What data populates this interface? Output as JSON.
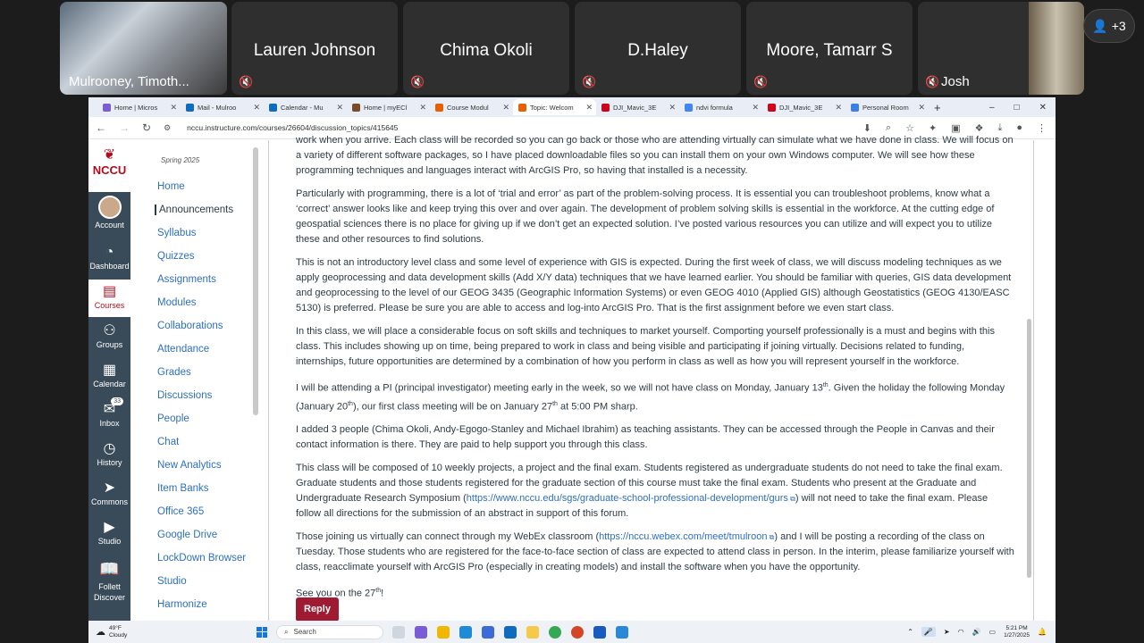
{
  "meeting": {
    "participants": [
      {
        "name": "Mulrooney, Timoth...",
        "muted": false
      },
      {
        "name": "Lauren Johnson",
        "muted": true
      },
      {
        "name": "Chima Okoli",
        "muted": true
      },
      {
        "name": "D.Haley",
        "muted": true
      },
      {
        "name": "Moore, Tamarr S",
        "muted": true
      },
      {
        "name": "Josh",
        "muted": true
      }
    ],
    "more_count": "+3"
  },
  "browser": {
    "tabs": [
      {
        "label": "Home | Micros",
        "color": "#7b5cd6"
      },
      {
        "label": "Mail - Mulroo",
        "color": "#0f6cbd"
      },
      {
        "label": "Calendar - Mu",
        "color": "#0f6cbd"
      },
      {
        "label": "Home | myECl",
        "color": "#7a4b2a"
      },
      {
        "label": "Course Modul",
        "color": "#e66000"
      },
      {
        "label": "Topic: Welcom",
        "color": "#e66000"
      },
      {
        "label": "DJI_Mavic_3E",
        "color": "#d0021b"
      },
      {
        "label": "ndvi formula",
        "color": "#4285f4"
      },
      {
        "label": "DJI_Mavic_3E",
        "color": "#d0021b"
      },
      {
        "label": "Personal Room",
        "color": "#3c7de6"
      }
    ],
    "active_tab": 5,
    "url": "nccu.instructure.com/courses/26604/discussion_topics/415645"
  },
  "global_nav": {
    "logo_text": "NCCU",
    "items": [
      {
        "label": "Account",
        "icon": "avatar-icon"
      },
      {
        "label": "Dashboard",
        "icon": "dashboard-icon"
      },
      {
        "label": "Courses",
        "icon": "book-icon",
        "active": true
      },
      {
        "label": "Groups",
        "icon": "groups-icon"
      },
      {
        "label": "Calendar",
        "icon": "calendar-icon"
      },
      {
        "label": "Inbox",
        "icon": "inbox-icon",
        "count": "33"
      },
      {
        "label": "History",
        "icon": "clock-icon"
      },
      {
        "label": "Commons",
        "icon": "commons-icon"
      },
      {
        "label": "Studio",
        "icon": "studio-icon"
      },
      {
        "label": "Follett Discover",
        "icon": "follett-icon"
      }
    ]
  },
  "course_nav": {
    "term": "Spring 2025",
    "items": [
      "Home",
      "Announcements",
      "Syllabus",
      "Quizzes",
      "Assignments",
      "Modules",
      "Collaborations",
      "Attendance",
      "Grades",
      "Discussions",
      "People",
      "Chat",
      "New Analytics",
      "Item Banks",
      "Office 365",
      "Google Drive",
      "LockDown Browser",
      "Studio",
      "Harmonize"
    ],
    "active": "Announcements"
  },
  "post": {
    "p0": "work when you arrive.  Each class will be recorded so you can go back or those who are attending virtually can simulate what we have done in class.  We will focus on a variety of different software packages, so I have placed downloadable files so you can install them on your own Windows computer.  We will see how these programming techniques and languages interact with ArcGIS Pro, so having that installed is a necessity.",
    "p1": "Particularly with programming, there is a lot of ‘trial and error’ as part of the problem-solving process.  It is essential you can troubleshoot problems, know what a ‘correct’ answer looks like and keep trying this over and over again.  The development of problem solving skills is essential in the workforce.  At the cutting edge of geospatial sciences there is no place for giving up if we don’t get an expected solution.  I’ve posted various resources you can utilize and will expect you to utilize these and other resources to find solutions.",
    "p2": "This is not an introductory level class and some level of experience with GIS is expected.  During the first week of class, we will discuss modeling techniques as we apply geoprocessing and data development skills (Add X/Y data) techniques that we have learned earlier.  You should be familiar with queries, GIS data development and geoprocessing to the level of our GEOG 3435 (Geographic Information Systems) or even GEOG 4010 (Applied GIS) although Geostatistics (GEOG 4130/EASC 5130) is preferred.  Please be sure you are able to access and log-into ArcGIS Pro.  That is the first assignment before we even start class.",
    "p3": "In this class, we will place a considerable focus on soft skills and techniques to market yourself.  Comporting yourself professionally is a must and begins with this class.  This includes showing up on time, being prepared to work in class and being visible and participating if joining virtually.   Decisions related to funding, internships, future opportunities are determined by a combination of how you perform in class as well as how you will represent yourself in the workforce.",
    "p4a": " I will be attending a PI (principal investigator) meeting early in the week, so we will not have class on Monday, January 13",
    "p4b": ".  Given the holiday the following Monday (January 20",
    "p4c": "), our first class meeting will be on January 27",
    "p4d": " at 5:00 PM sharp.",
    "sup": "th",
    "p5": "I added 3 people (Chima Okoli, Andy-Egogo-Stanley and Michael Ibrahim) as teaching assistants.  They can be accessed through the People in Canvas and their contact information is there.  They are paid to help support you through this class.",
    "p6a": "This class will be composed of 10 weekly projects, a project and the final exam.  Students registered as undergraduate students do not need to take the final exam.  Graduate students and those students registered for the graduate section of this course must take the final exam.  Students who present at the Graduate and Undergraduate Research Symposium (",
    "p6link": "https://www.nccu.edu/sgs/graduate-school-professional-development/gurs",
    "p6b": ") will not need to take the final exam.   Please follow all directions for the submission of an abstract in support of this forum.",
    "p7a": "Those joining us virtually can connect through my WebEx classroom (",
    "p7link": "https://nccu.webex.com/meet/tmulroon",
    "p7b": ") and I will be posting a recording of the class on Tuesday.  Those students who are registered for the face-to-face section of class are expected to attend class in person.  In the interim, please familiarize yourself with class, reacclimate yourself with ArcGIS Pro (especially in creating models) and install the software when you have the opportunity.",
    "p8a": "See you on the 27",
    "p8b": "!",
    "reply": "Reply"
  },
  "taskbar": {
    "temp": "49°F",
    "weather": "Cloudy",
    "search": "Search",
    "time": "5:21 PM",
    "date": "1/27/2025"
  }
}
